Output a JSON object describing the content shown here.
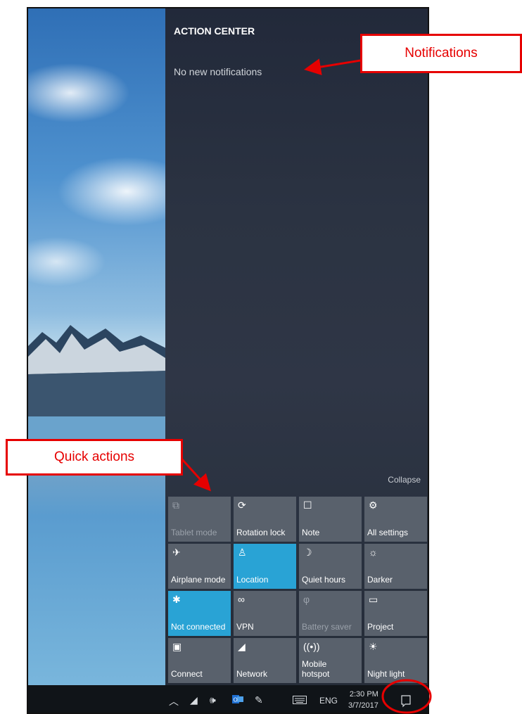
{
  "action_center": {
    "title": "ACTION CENTER",
    "empty_message": "No new notifications",
    "collapse_label": "Collapse"
  },
  "quick_actions": [
    {
      "label": "Tablet mode",
      "icon": "tablet-mode-icon",
      "glyph": "⧉",
      "state": "disabled"
    },
    {
      "label": "Rotation lock",
      "icon": "rotation-lock-icon",
      "glyph": "⟳",
      "state": "normal"
    },
    {
      "label": "Note",
      "icon": "note-icon",
      "glyph": "☐",
      "state": "normal"
    },
    {
      "label": "All settings",
      "icon": "gear-icon",
      "glyph": "⚙",
      "state": "normal"
    },
    {
      "label": "Airplane mode",
      "icon": "airplane-icon",
      "glyph": "✈",
      "state": "normal"
    },
    {
      "label": "Location",
      "icon": "location-icon",
      "glyph": "♙",
      "state": "active"
    },
    {
      "label": "Quiet hours",
      "icon": "moon-icon",
      "glyph": "☽",
      "state": "normal"
    },
    {
      "label": "Darker",
      "icon": "brightness-icon",
      "glyph": "☼",
      "state": "normal"
    },
    {
      "label": "Not connected",
      "icon": "bluetooth-icon",
      "glyph": "✱",
      "state": "active"
    },
    {
      "label": "VPN",
      "icon": "vpn-icon",
      "glyph": "∞",
      "state": "normal"
    },
    {
      "label": "Battery saver",
      "icon": "battery-saver-icon",
      "glyph": "φ",
      "state": "disabled"
    },
    {
      "label": "Project",
      "icon": "project-icon",
      "glyph": "▭",
      "state": "normal"
    },
    {
      "label": "Connect",
      "icon": "connect-icon",
      "glyph": "▣",
      "state": "normal"
    },
    {
      "label": "Network",
      "icon": "network-icon",
      "glyph": "◢",
      "state": "normal"
    },
    {
      "label": "Mobile\nhotspot",
      "icon": "hotspot-icon",
      "glyph": "((•))",
      "state": "normal"
    },
    {
      "label": "Night light",
      "icon": "night-light-icon",
      "glyph": "☀",
      "state": "normal"
    }
  ],
  "taskbar": {
    "language": "ENG",
    "time": "2:30 PM",
    "date": "3/7/2017",
    "icons": [
      "chevron-up-icon",
      "wifi-icon",
      "volume-icon",
      "outlook-icon",
      "pen-icon",
      "keyboard-icon"
    ]
  },
  "callouts": {
    "notifications": "Notifications",
    "quick_actions": "Quick actions"
  },
  "colors": {
    "tile": "#59616c",
    "tile_active": "#29a3d5",
    "callout_red": "#e60000"
  }
}
